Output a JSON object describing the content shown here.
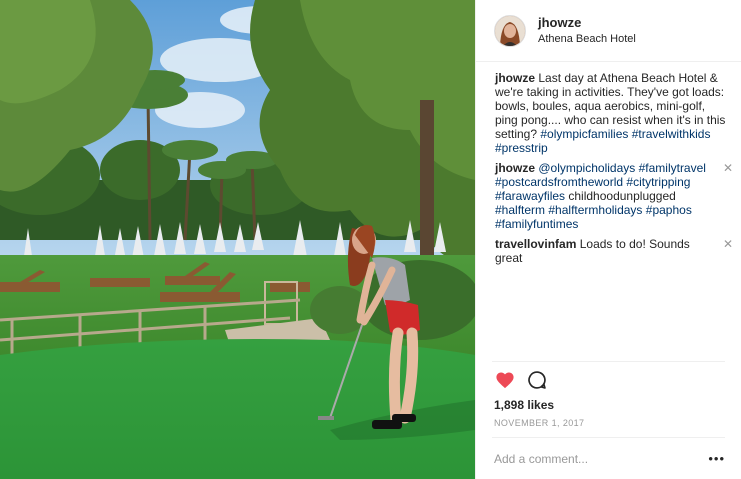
{
  "header": {
    "username": "jhowze",
    "location": "Athena Beach Hotel"
  },
  "caption": {
    "user": "jhowze",
    "text": "Last day at Athena Beach Hotel & we're taking in activities. They've got loads: bowls, boules, aqua aerobics, mini-golf, ping pong.... who can resist when it's in this setting?",
    "hashtags": [
      "#olympicfamilies",
      "#travelwithkids",
      "#presstrip"
    ]
  },
  "comments": [
    {
      "user": "jhowze",
      "parts": [
        "@olympicholidays",
        "#familytravel",
        "#postcardsfromtheworld",
        "#citytripping",
        "#farawayfiles",
        "childhoodunplugged",
        "#halfterm",
        "#halftermholidays",
        "#paphos",
        "#familyfuntimes"
      ],
      "close": "✕"
    },
    {
      "user": "travellovinfam",
      "text": "Loads to do! Sounds great",
      "close": "✕"
    }
  ],
  "actions": {
    "like_icon": "heart-filled-icon",
    "comment_icon": "comment-bubble-icon",
    "like_color": "#ed4956",
    "likes": "1,898 likes",
    "date": "NOVEMBER 1, 2017"
  },
  "add_comment": {
    "placeholder": "Add a comment...",
    "more": "•••"
  }
}
